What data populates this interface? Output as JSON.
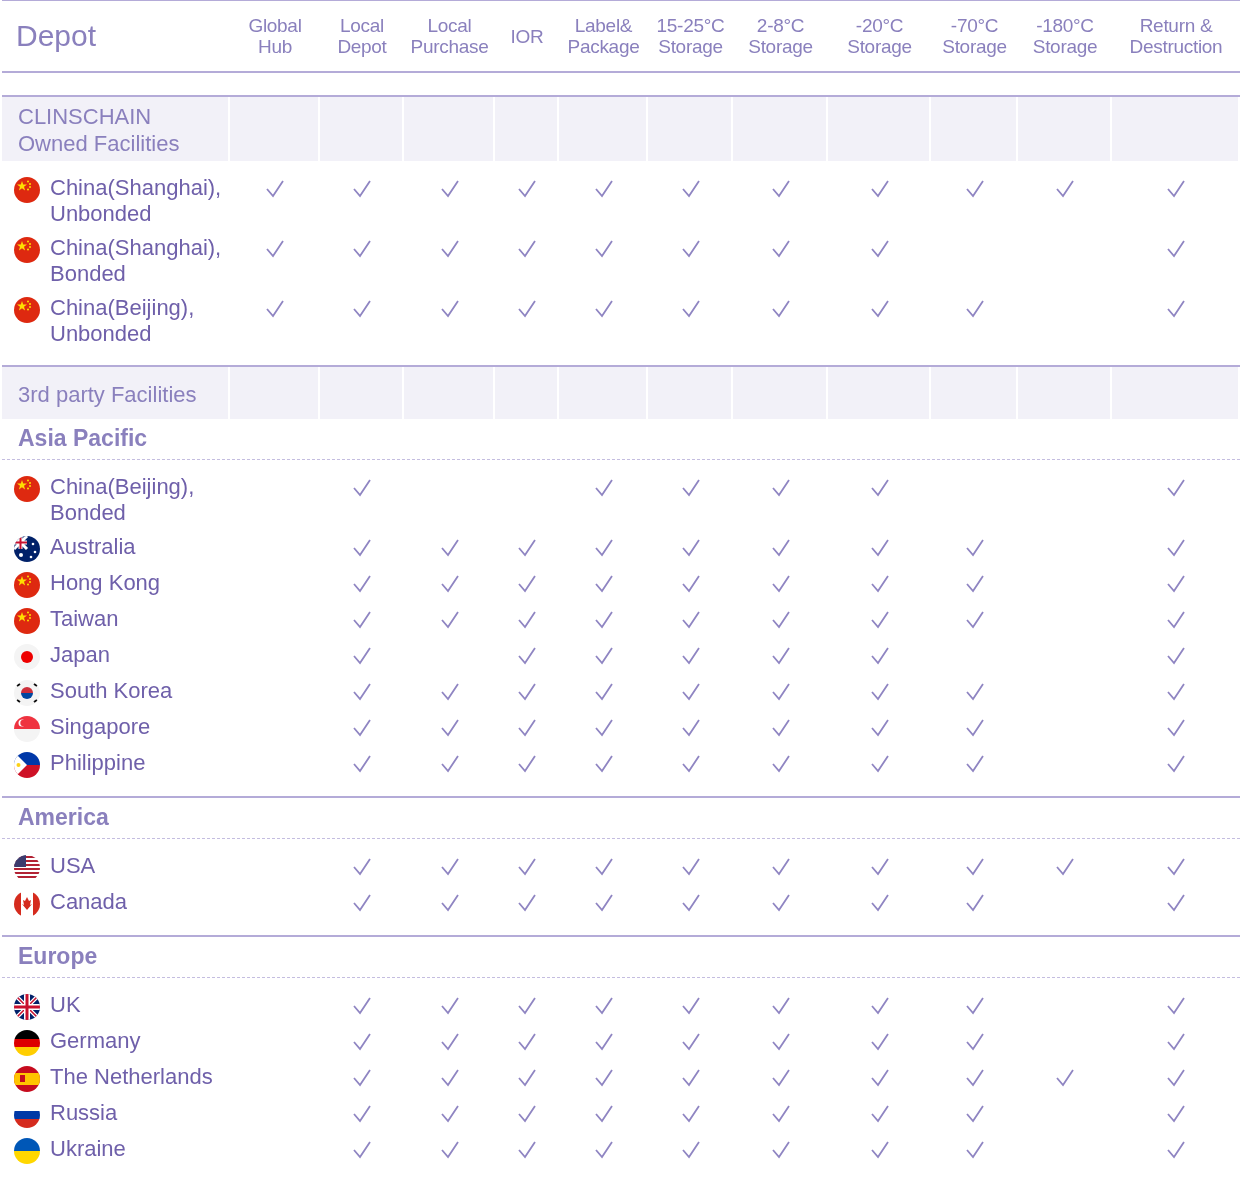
{
  "header": {
    "title": "Depot",
    "columns": [
      "Global Hub",
      "Local Depot",
      "Local Purchase",
      "IOR",
      "Label& Package",
      "15-25°C Storage",
      "2-8°C Storage",
      "-20°C Storage",
      "-70°C Storage",
      "-180°C Storage",
      "Return & Destruction"
    ]
  },
  "sections": [
    {
      "kind": "band",
      "title": "CLINSCHAIN Owned Facilities",
      "rows": [
        {
          "name": "China(Shanghai), Unbonded",
          "kind": "cn",
          "checks": [
            true,
            true,
            true,
            true,
            true,
            true,
            true,
            true,
            true,
            true,
            true
          ]
        },
        {
          "name": "China(Shanghai), Bonded",
          "kind": "cn",
          "checks": [
            true,
            true,
            true,
            true,
            true,
            true,
            true,
            true,
            false,
            false,
            true
          ]
        },
        {
          "name": "China(Beijing), Unbonded",
          "kind": "cn",
          "checks": [
            true,
            true,
            true,
            true,
            true,
            true,
            true,
            true,
            true,
            false,
            true
          ]
        }
      ]
    },
    {
      "kind": "band",
      "title": "3rd party Facilities"
    },
    {
      "kind": "region",
      "title": "Asia Pacific",
      "rows": [
        {
          "name": "China(Beijing), Bonded",
          "kind": "cn",
          "checks": [
            false,
            true,
            false,
            false,
            true,
            true,
            true,
            true,
            false,
            false,
            true
          ]
        },
        {
          "name": "Australia",
          "kind": "au",
          "checks": [
            false,
            true,
            true,
            true,
            true,
            true,
            true,
            true,
            true,
            false,
            true
          ]
        },
        {
          "name": "Hong Kong",
          "kind": "cn",
          "checks": [
            false,
            true,
            true,
            true,
            true,
            true,
            true,
            true,
            true,
            false,
            true
          ]
        },
        {
          "name": "Taiwan",
          "kind": "cn",
          "checks": [
            false,
            true,
            true,
            true,
            true,
            true,
            true,
            true,
            true,
            false,
            true
          ]
        },
        {
          "name": "Japan",
          "kind": "jp",
          "checks": [
            false,
            true,
            false,
            true,
            true,
            true,
            true,
            true,
            false,
            false,
            true
          ]
        },
        {
          "name": "South Korea",
          "kind": "kr",
          "checks": [
            false,
            true,
            true,
            true,
            true,
            true,
            true,
            true,
            true,
            false,
            true
          ]
        },
        {
          "name": "Singapore",
          "kind": "sg",
          "checks": [
            false,
            true,
            true,
            true,
            true,
            true,
            true,
            true,
            true,
            false,
            true
          ]
        },
        {
          "name": "Philippine",
          "kind": "ph",
          "checks": [
            false,
            true,
            true,
            true,
            true,
            true,
            true,
            true,
            true,
            false,
            true
          ]
        }
      ]
    },
    {
      "kind": "region",
      "title": "America",
      "rows": [
        {
          "name": "USA",
          "kind": "us",
          "checks": [
            false,
            true,
            true,
            true,
            true,
            true,
            true,
            true,
            true,
            true,
            true
          ]
        },
        {
          "name": "Canada",
          "kind": "ca",
          "checks": [
            false,
            true,
            true,
            true,
            true,
            true,
            true,
            true,
            true,
            false,
            true
          ]
        }
      ]
    },
    {
      "kind": "region",
      "title": "Europe",
      "rows": [
        {
          "name": "UK",
          "kind": "gb",
          "checks": [
            false,
            true,
            true,
            true,
            true,
            true,
            true,
            true,
            true,
            false,
            true
          ]
        },
        {
          "name": "Germany",
          "kind": "de",
          "checks": [
            false,
            true,
            true,
            true,
            true,
            true,
            true,
            true,
            true,
            false,
            true
          ]
        },
        {
          "name": "The Netherlands",
          "kind": "es",
          "checks": [
            false,
            true,
            true,
            true,
            true,
            true,
            true,
            true,
            true,
            true,
            true
          ]
        },
        {
          "name": "Russia",
          "kind": "ru",
          "checks": [
            false,
            true,
            true,
            true,
            true,
            true,
            true,
            true,
            true,
            false,
            true
          ]
        },
        {
          "name": "Ukraine",
          "kind": "ua",
          "checks": [
            false,
            true,
            true,
            true,
            true,
            true,
            true,
            true,
            true,
            false,
            true
          ]
        }
      ]
    }
  ]
}
